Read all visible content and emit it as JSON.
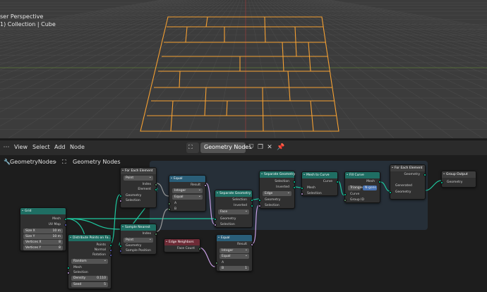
{
  "viewport": {
    "perspective_label": "ser Perspective",
    "collection_label": "1) Collection | Cube"
  },
  "node_header": {
    "menus": [
      "View",
      "Select",
      "Add",
      "Node"
    ],
    "node_tree_name": "Geometry Nodes"
  },
  "breadcrumb": {
    "modifier": "GeometryNodes",
    "tree": "Geometry Nodes"
  },
  "nodes": {
    "grid": {
      "title": "Grid",
      "out_mesh": "Mesh",
      "out_uv": "UV Map",
      "size_x_label": "Size X",
      "size_x": "10 m",
      "size_y_label": "Size Y",
      "size_y": "10 m",
      "vx_label": "Vertices X",
      "vx": "8",
      "vy_label": "Vertices Y",
      "vy": "8"
    },
    "distribute": {
      "title": "Distribute Points on Fa…",
      "out_points": "Points",
      "out_normal": "Normal",
      "out_rotation": "Rotation",
      "mode": "Random",
      "in_mesh": "Mesh",
      "in_selection": "Selection",
      "density_label": "Density",
      "density": "0.110",
      "seed_label": "Seed",
      "seed": "5"
    },
    "foreach_in": {
      "title": "For Each Element",
      "domain": "Point",
      "out_index": "Index",
      "out_element": "Element",
      "in_geometry": "Geometry",
      "in_selection": "Selection"
    },
    "sample_nearest": {
      "title": "Sample Nearest",
      "out_index": "Index",
      "domain": "Point",
      "in_geometry": "Geometry",
      "in_sample_pos": "Sample Position"
    },
    "equal1": {
      "title": "Equal",
      "out_result": "Result",
      "type": "Integer",
      "op": "Equal",
      "in_a": "A",
      "in_b": "B"
    },
    "edge_neighbors": {
      "title": "Edge Neighbors",
      "out_face_count": "Face Count"
    },
    "equal2": {
      "title": "Equal",
      "out_result": "Result",
      "type": "Integer",
      "op": "Equal",
      "in_a": "A",
      "b_label": "B",
      "b": "1"
    },
    "separate1": {
      "title": "Separate Geometry",
      "out_selection": "Selection",
      "out_inverted": "Inverted",
      "domain": "Face",
      "in_geometry": "Geometry",
      "in_selection": "Selection"
    },
    "separate2": {
      "title": "Separate Geometry",
      "out_selection": "Selection",
      "out_inverted": "Inverted",
      "domain": "Edge",
      "in_geometry": "Geometry",
      "in_selection": "Selection"
    },
    "mesh_to_curve": {
      "title": "Mesh to Curve",
      "out_curve": "Curve",
      "in_mesh": "Mesh",
      "in_selection": "Selection"
    },
    "fill_curve": {
      "title": "Fill Curve",
      "out_mesh": "Mesh",
      "mode_a": "Triangles",
      "mode_b": "N-gons",
      "in_curve": "Curve",
      "in_group_id": "Group ID"
    },
    "foreach_out": {
      "title": "For Each Element",
      "out_geometry": "Geometry",
      "generated": "Generated",
      "in_geometry": "Geometry"
    },
    "group_output": {
      "title": "Group Output",
      "in_geometry": "Geometry"
    }
  },
  "colors": {
    "geometry_socket": "#00d6a3",
    "wire": "#1ec9a0",
    "selection_outline": "#f5a032",
    "frame": "#28323d"
  }
}
